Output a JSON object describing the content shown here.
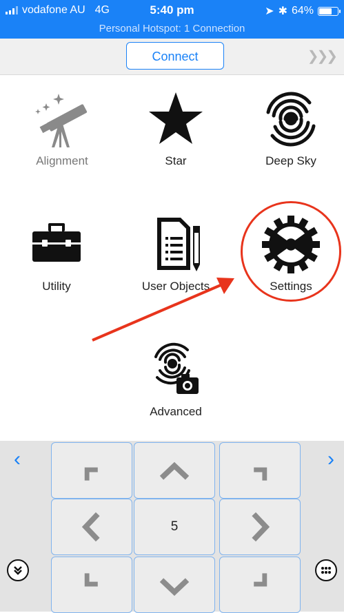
{
  "status_bar": {
    "carrier": "vodafone AU",
    "network": "4G",
    "time": "5:40 pm",
    "battery": "64%",
    "battery_level": 0.64,
    "hotspot": "Personal Hotspot: 1 Connection"
  },
  "toolbar": {
    "connect_label": "Connect",
    "more_icon": "triple-chevron-right-icon"
  },
  "menu": {
    "items": [
      {
        "label": "Alignment",
        "icon": "telescope-icon"
      },
      {
        "label": "Star",
        "icon": "star-icon"
      },
      {
        "label": "Deep Sky",
        "icon": "galaxy-icon"
      },
      {
        "label": "Utility",
        "icon": "toolbox-icon"
      },
      {
        "label": "User Objects",
        "icon": "document-pencil-icon"
      },
      {
        "label": "Settings",
        "icon": "gear-icon"
      },
      {
        "label": "Advanced",
        "icon": "galaxy-camera-icon"
      }
    ]
  },
  "annotation": {
    "color": "#e8341c"
  },
  "keypad": {
    "center_value": "5"
  },
  "colors": {
    "accent": "#1a82f7",
    "pad_border": "#7fb3ee",
    "icon_gray": "#888888"
  }
}
